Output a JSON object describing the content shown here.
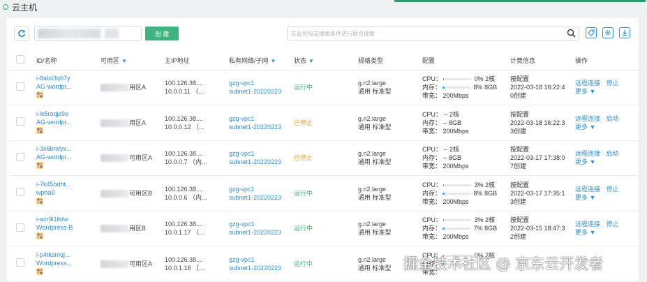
{
  "header": {
    "title": "云主机",
    "accent_color": "#2b9a6a"
  },
  "toolbar": {
    "create_label": "创 建",
    "search_placeholder": "在此处指定搜索条件进行联合搜索",
    "icons": [
      "refresh-icon",
      "search-icon",
      "tag-icon",
      "gear-icon",
      "download-icon"
    ]
  },
  "table": {
    "columns": {
      "id_name": "ID/名称",
      "zone": "可用区",
      "ip": "主IP地址",
      "network": "私有网络/子网",
      "status": "状态",
      "spec": "规格类型",
      "config": "配置",
      "billing": "计费信息",
      "ops": "操作"
    },
    "rows": [
      {
        "id": "i-8abii3qb7y",
        "name": "AG-wordpr...",
        "zone": "用区A",
        "ip1": "100.126.38....",
        "ip2": "10.0.0.11 （...",
        "vpc": "gzg-vpc1",
        "subnet": "subnet1-20220223",
        "status": "运行中",
        "status_type": "running",
        "spec1": "g.n2.large",
        "spec2": "通用 标准型",
        "cpu_label": "CPU：",
        "cpu_pct": "0%",
        "cpu_fill": 0,
        "cpu_cores": "2核",
        "mem_label": "内存：",
        "mem_pct": "8%",
        "mem_fill": 8,
        "mem_size": "8GB",
        "bw_label": "带宽：",
        "bw": "200Mbps",
        "bill1": "按配置",
        "bill2": "2022-03-18 16:22:4",
        "bill3": "0创建",
        "op1": "远程连接",
        "op2": "停止",
        "more": "更多"
      },
      {
        "id": "i-ik5roqjs9o",
        "name": "AG-wordpr...",
        "zone": "用区A",
        "ip1": "100.126.38....",
        "ip2": "10.0.0.12 （...",
        "vpc": "gzg-vpc1",
        "subnet": "subnet1-20220223",
        "status": "已停止",
        "status_type": "stopped",
        "spec1": "g.n2.large",
        "spec2": "通用 标准型",
        "cpu_label": "CPU：",
        "cpu_pct": "--",
        "cpu_fill": null,
        "cpu_cores": "2核",
        "mem_label": "内存：",
        "mem_pct": "--",
        "mem_fill": null,
        "mem_size": "8GB",
        "bw_label": "带宽：",
        "bw": "200Mbps",
        "bill1": "按配置",
        "bill2": "2022-03-18 16:22:3",
        "bill3": "3创建",
        "op1": "远程连接",
        "op2": "启动",
        "more": "更多"
      },
      {
        "id": "i-3x6bmlyx...",
        "name": "AG-wordpr...",
        "zone": "可用区A",
        "ip1": "100.126.38....",
        "ip2": "10.0.0.7 （内...",
        "vpc": "gzg-vpc1",
        "subnet": "subnet1-20220223",
        "status": "已停止",
        "status_type": "stopped",
        "spec1": "g.n2.large",
        "spec2": "通用 标准型",
        "cpu_label": "CPU：",
        "cpu_pct": "--",
        "cpu_fill": null,
        "cpu_cores": "2核",
        "mem_label": "内存：",
        "mem_pct": "--",
        "mem_fill": null,
        "mem_size": "8GB",
        "bw_label": "带宽：",
        "bw": "200Mbps",
        "bill1": "按配置",
        "bill2": "2022-03-17 17:38:0",
        "bill3": "7创建",
        "op1": "远程连接",
        "op2": "启动",
        "more": "更多"
      },
      {
        "id": "i-7k45bdht...",
        "name": "wpha0",
        "zone": "可用区B",
        "ip1": "100.126.38....",
        "ip2": "10.0.0.6 （内...",
        "vpc": "gzg-vpc1",
        "subnet": "subnet1-20220223",
        "status": "运行中",
        "status_type": "running",
        "spec1": "g.n2.large",
        "spec2": "通用 标准型",
        "cpu_label": "CPU：",
        "cpu_pct": "3%",
        "cpu_fill": 3,
        "cpu_cores": "2核",
        "mem_label": "内存：",
        "mem_pct": "8%",
        "mem_fill": 8,
        "mem_size": "8GB",
        "bw_label": "带宽：",
        "bw": "200Mbps",
        "bill1": "按配置",
        "bill2": "2022-03-17 17:35:1",
        "bill3": "3创建",
        "op1": "远程连接",
        "op2": "停止",
        "more": "更多"
      },
      {
        "id": "i-azr9i1tldw",
        "name": "Wordpress-B",
        "zone": "用区B",
        "ip1": "100.126.38....",
        "ip2": "10.0.1.17 （...",
        "vpc": "gzg-vpc1",
        "subnet": "subnet1-20220223",
        "status": "运行中",
        "status_type": "running",
        "spec1": "g.n2.large",
        "spec2": "通用 标准型",
        "cpu_label": "CPU：",
        "cpu_pct": "3%",
        "cpu_fill": 3,
        "cpu_cores": "2核",
        "mem_label": "内存：",
        "mem_pct": "7%",
        "mem_fill": 7,
        "mem_size": "8GB",
        "bw_label": "带宽：",
        "bw": "200Mbps",
        "bill1": "按配置",
        "bill2": "2022-03-15 18:47:3",
        "bill3": "2创建",
        "op1": "远程连接",
        "op2": "停止",
        "more": "更多"
      },
      {
        "id": "i-p4tksmqj...",
        "name": "Wordpress...",
        "zone": "可用区A",
        "ip1": "100.126.38....",
        "ip2": "10.0.1.16 （...",
        "vpc": "gzg-vpc1",
        "subnet": "subnet1-20220223",
        "status": "运行中",
        "status_type": "running",
        "spec1": "g.n2.large",
        "spec2": "通用 标准型",
        "cpu_label": "CPU：",
        "cpu_pct": "0%",
        "cpu_fill": 0,
        "cpu_cores": "2核",
        "mem_label": "内存：",
        "mem_pct": "",
        "mem_fill": 8,
        "mem_size": "",
        "bw_label": "带宽：",
        "bw": "",
        "bill1": "",
        "bill2": "",
        "bill3": "",
        "op1": "",
        "op2": "",
        "more": ""
      }
    ]
  },
  "watermark": "掘金技术社区 @ 京东云开发者",
  "colors": {
    "link": "#2f8fd8",
    "running": "#3cae6b",
    "stopped": "#f0a020",
    "create_button": "#3fb27f",
    "usage_bar": "#3fb2e8"
  }
}
